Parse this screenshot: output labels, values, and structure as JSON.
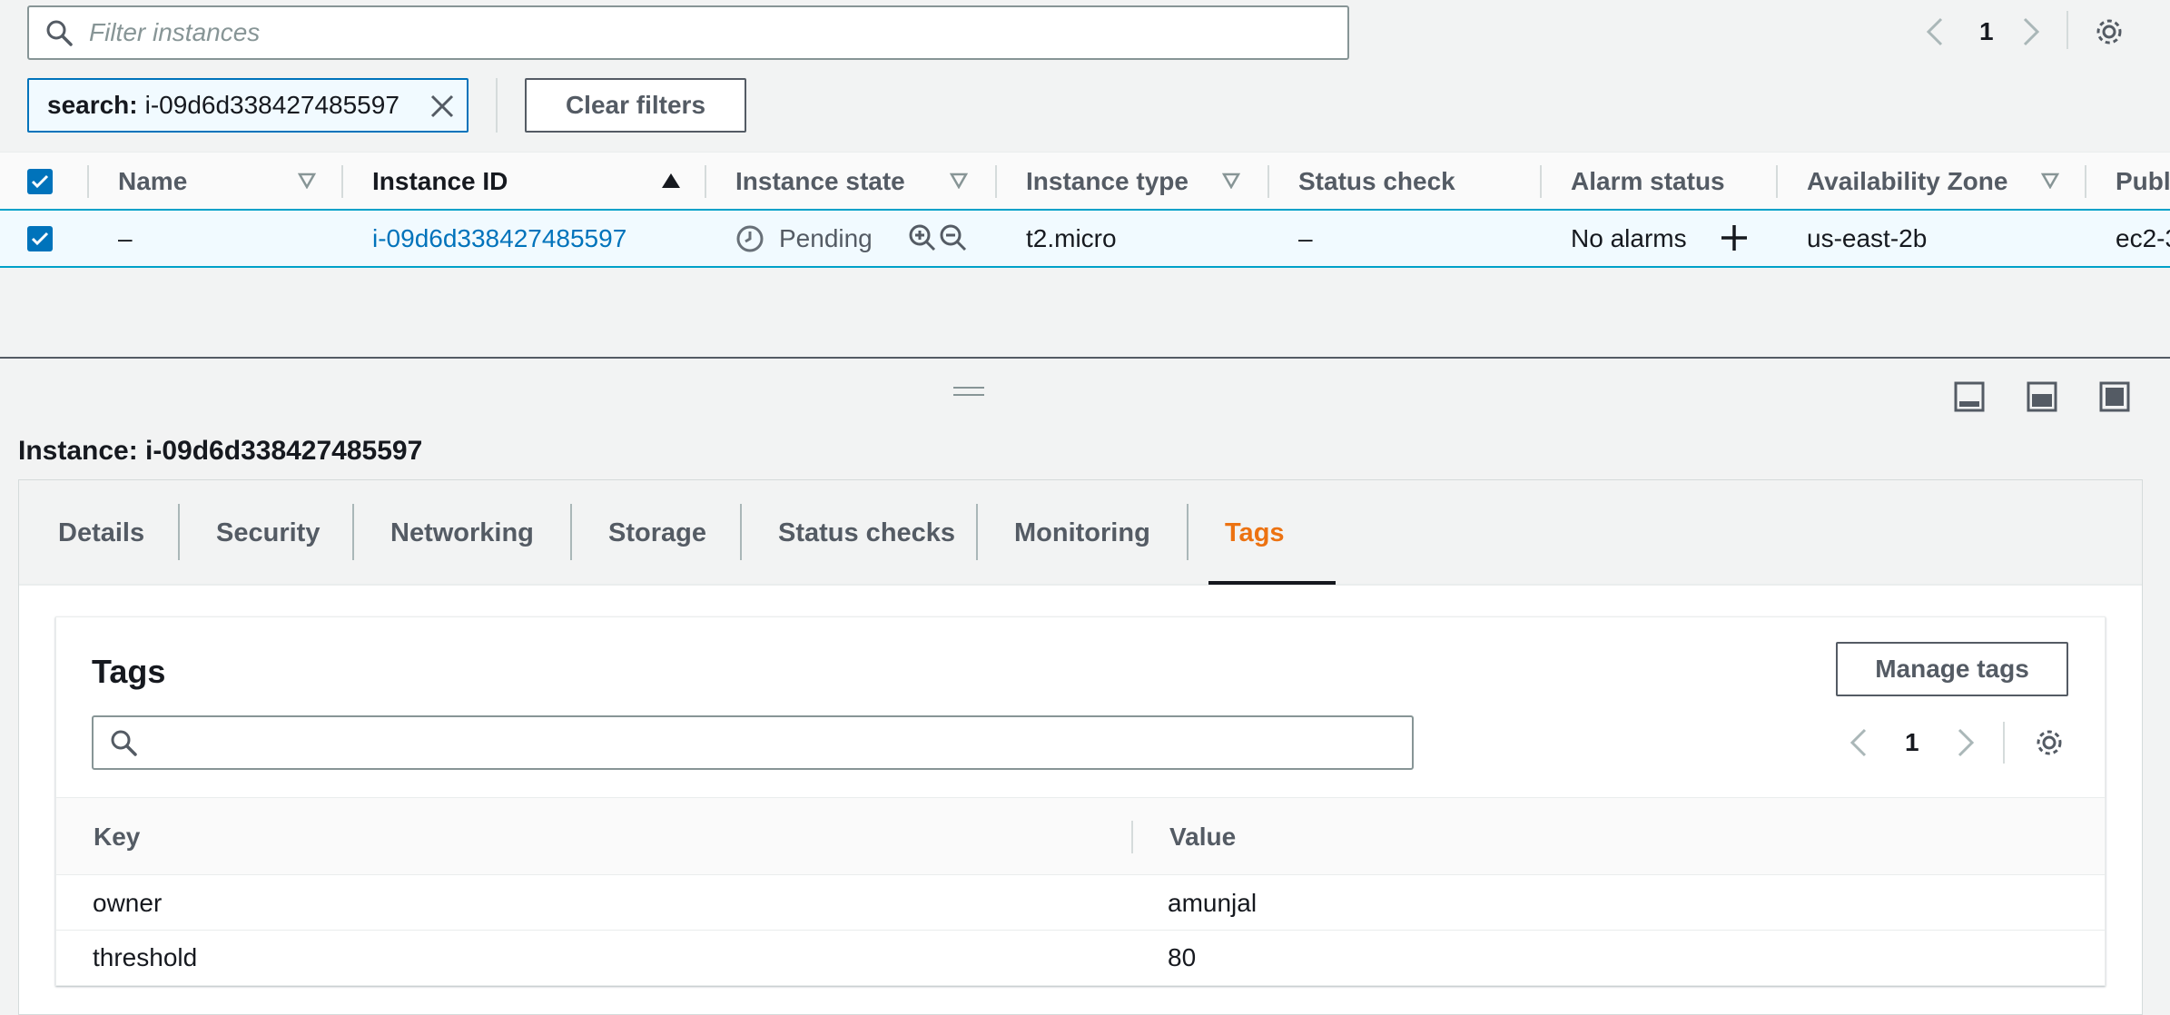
{
  "filter": {
    "placeholder": "Filter instances",
    "page": "1"
  },
  "token": {
    "label": "search:",
    "value": "i-09d6d338427485597"
  },
  "clear_filters_label": "Clear filters",
  "table": {
    "columns": [
      "Name",
      "Instance ID",
      "Instance state",
      "Instance type",
      "Status check",
      "Alarm status",
      "Availability Zone",
      "Publ"
    ],
    "row": {
      "selected": true,
      "name": "–",
      "instance_id": "i-09d6d338427485597",
      "state": "Pending",
      "type": "t2.micro",
      "status_check": "–",
      "alarm_status": "No alarms",
      "az": "us-east-2b",
      "public": "ec2-3"
    }
  },
  "details": {
    "title": "Instance: i-09d6d338427485597",
    "tabs": [
      "Details",
      "Security",
      "Networking",
      "Storage",
      "Status checks",
      "Monitoring",
      "Tags"
    ],
    "active_tab": "Tags"
  },
  "tags": {
    "title": "Tags",
    "manage_label": "Manage tags",
    "page": "1",
    "columns": [
      "Key",
      "Value"
    ],
    "rows": [
      {
        "key": "owner",
        "value": "amunjal"
      },
      {
        "key": "threshold",
        "value": "80"
      }
    ]
  },
  "colors": {
    "accent_blue": "#0073bb",
    "active_tab": "#ec7211",
    "selected_row_bg": "#f1faff"
  }
}
